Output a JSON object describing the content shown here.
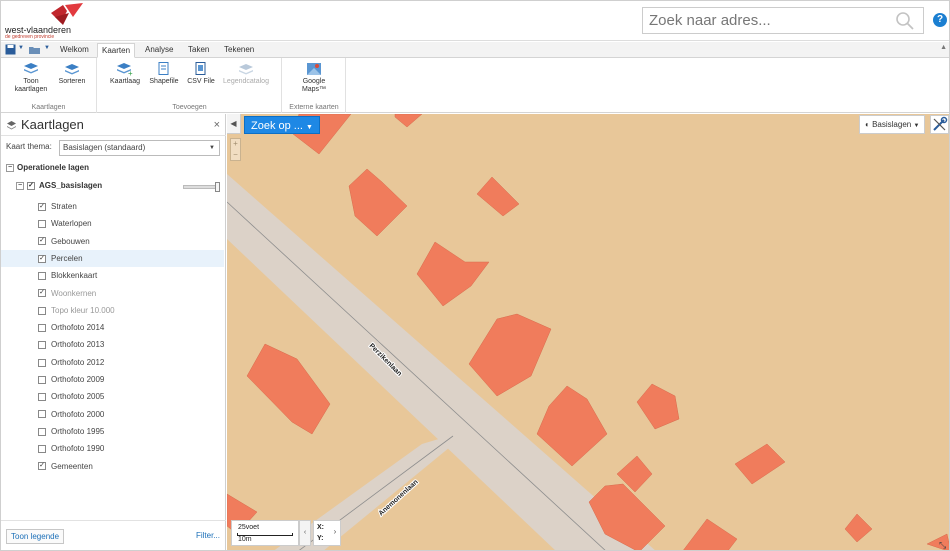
{
  "header": {
    "logo_text": "west-vlaanderen",
    "logo_subtitle": "de gedreven provincie",
    "search_placeholder": "Zoek naar adres...",
    "help_label": "?"
  },
  "ribbon": {
    "tabs": [
      {
        "label": "Welkom"
      },
      {
        "label": "Kaarten"
      },
      {
        "label": "Analyse"
      },
      {
        "label": "Taken"
      },
      {
        "label": "Tekenen"
      }
    ],
    "active_tab": "Kaarten",
    "groups": [
      {
        "title": "Kaartlagen",
        "buttons": [
          {
            "label": "Toon kaartlagen"
          },
          {
            "label": "Sorteren"
          }
        ]
      },
      {
        "title": "Toevoegen",
        "buttons": [
          {
            "label": "Kaartlaag"
          },
          {
            "label": "Shapefile"
          },
          {
            "label": "CSV File"
          },
          {
            "label": "Legendcatalog"
          }
        ]
      },
      {
        "title": "Externe kaarten",
        "buttons": [
          {
            "label": "Google Maps™"
          }
        ]
      }
    ]
  },
  "panel": {
    "title": "Kaartlagen",
    "close_label": "×",
    "theme_label": "Kaart thema:",
    "theme_value": "Basislagen (standaard)",
    "section_label": "Operationele lagen",
    "group_label": "AGS_basislagen",
    "layers": [
      {
        "label": "Straten",
        "checked": true
      },
      {
        "label": "Waterlopen",
        "checked": false
      },
      {
        "label": "Gebouwen",
        "checked": true
      },
      {
        "label": "Percelen",
        "checked": true
      },
      {
        "label": "Blokkenkaart",
        "checked": false
      },
      {
        "label": "Woonkernen",
        "checked": true
      },
      {
        "label": "Topo kleur 10.000",
        "checked": false
      },
      {
        "label": "Orthofoto 2014",
        "checked": false
      },
      {
        "label": "Orthofoto 2013",
        "checked": false
      },
      {
        "label": "Orthofoto 2012",
        "checked": false
      },
      {
        "label": "Orthofoto 2009",
        "checked": false
      },
      {
        "label": "Orthofoto 2005",
        "checked": false
      },
      {
        "label": "Orthofoto 2000",
        "checked": false
      },
      {
        "label": "Orthofoto 1995",
        "checked": false
      },
      {
        "label": "Orthofoto 1990",
        "checked": false
      },
      {
        "label": "Gemeenten",
        "checked": true
      }
    ],
    "legend_button": "Toon legende",
    "filter_link": "Filter..."
  },
  "map": {
    "zoek_button": "Zoek op ...",
    "basemap_button": "Basislagen",
    "street_labels": [
      "Perzikenlaan",
      "Anemonenlaan"
    ],
    "scale_upper": "25voet",
    "scale_lower": "10m",
    "coord_x_label": "X:",
    "coord_y_label": "Y:",
    "colors": {
      "parcel": "#e8c799",
      "road": "#dcd2c8",
      "building": "#f07c5c"
    }
  }
}
